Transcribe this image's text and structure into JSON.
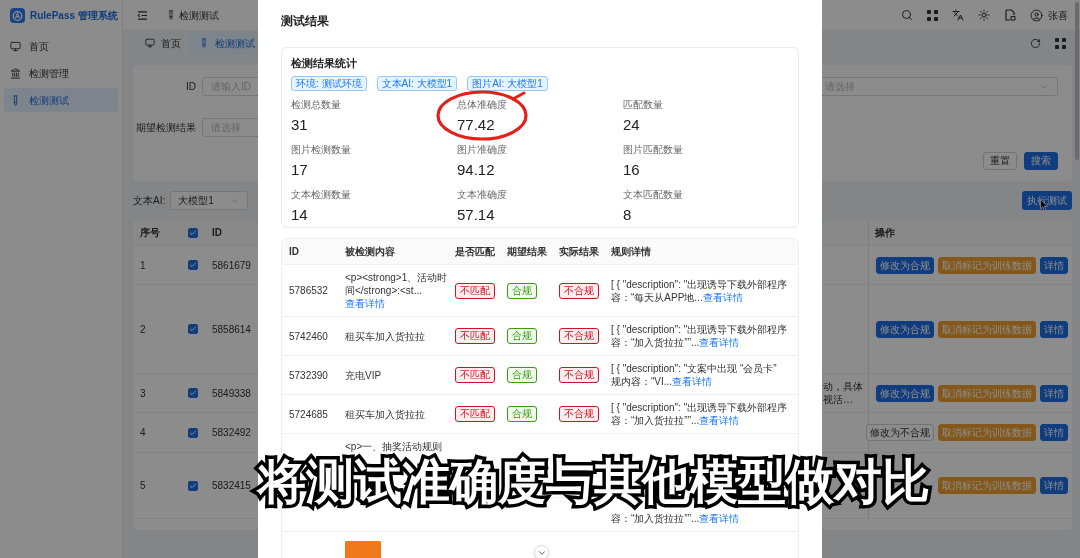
{
  "sidebar": {
    "logo": "RulePass 管理系统",
    "items": [
      {
        "label": "首页",
        "selected": false
      },
      {
        "label": "检测管理",
        "selected": false
      },
      {
        "label": "检测测试",
        "selected": true
      }
    ]
  },
  "header": {
    "breadcrumb": "检测测试",
    "user": "张喜"
  },
  "page_tabs": [
    {
      "label": "首页",
      "selected": false
    },
    {
      "label": "检测测试",
      "selected": true
    }
  ],
  "search_form": {
    "fields": [
      {
        "label": "ID",
        "placeholder": "请输入ID"
      },
      {
        "label": "期望检测结果",
        "placeholder": "请选择"
      }
    ],
    "select": {
      "placeholder": "请选择"
    },
    "buttons": [
      {
        "label": "重置",
        "kind": "default"
      },
      {
        "label": "搜索",
        "kind": "primary"
      }
    ]
  },
  "toolbar": {
    "label": "文本AI:",
    "select_value": "大模型1",
    "run_button": "执行测试"
  },
  "table": {
    "columns": [
      "序号",
      "ID",
      "操作"
    ],
    "all_checked": true,
    "rows": [
      {
        "index": "1",
        "checked": true,
        "id": "5861679",
        "actions": [
          {
            "label": "修改为合规",
            "kind": "primary"
          },
          {
            "label": "取消标记为训练数据",
            "kind": "warning"
          },
          {
            "label": "详情",
            "kind": "primary"
          }
        ]
      },
      {
        "index": "2",
        "checked": true,
        "id": "5858614",
        "actions": [
          {
            "label": "修改为合规",
            "kind": "primary"
          },
          {
            "label": "取消标记为训练数据",
            "kind": "warning"
          },
          {
            "label": "详情",
            "kind": "primary"
          }
        ]
      },
      {
        "index": "3",
        "checked": true,
        "id": "5849338",
        "detail": "动，具体视活…",
        "actions": [
          {
            "label": "修改为合规",
            "kind": "primary"
          },
          {
            "label": "取消标记为训练数据",
            "kind": "warning"
          },
          {
            "label": "详情",
            "kind": "primary"
          }
        ]
      },
      {
        "index": "4",
        "checked": true,
        "id": "5832492",
        "actions": [
          {
            "label": "修改为不合规",
            "kind": "default"
          },
          {
            "label": "取消标记为训练数据",
            "kind": "warning"
          },
          {
            "label": "详情",
            "kind": "primary"
          }
        ]
      },
      {
        "index": "5",
        "checked": true,
        "id": "5832415",
        "actions": [
          {
            "label": "取消标记为训练数据",
            "kind": "warning"
          },
          {
            "label": "详情",
            "kind": "primary"
          }
        ]
      }
    ]
  },
  "modal": {
    "title": "测试结果",
    "stats_card": {
      "title": "检测结果统计",
      "tags": [
        "环境: 测试环境",
        "文本AI: 大模型1",
        "图片AI: 大模型1"
      ],
      "stats": [
        {
          "label": "检测总数量",
          "value": "31"
        },
        {
          "label": "总体准确度",
          "value": "77.42"
        },
        {
          "label": "匹配数量",
          "value": "24"
        },
        {
          "label": "图片检测数量",
          "value": "17"
        },
        {
          "label": "图片准确度",
          "value": "94.12"
        },
        {
          "label": "图片匹配数量",
          "value": "16"
        },
        {
          "label": "文本检测数量",
          "value": "14"
        },
        {
          "label": "文本准确度",
          "value": "57.14"
        },
        {
          "label": "文本匹配数量",
          "value": "8"
        }
      ]
    },
    "results_table": {
      "columns": [
        "ID",
        "被检测内容",
        "是否匹配",
        "期望结果",
        "实际结果",
        "规则详情"
      ],
      "rows": [
        {
          "kind": "full",
          "id": "5786532",
          "content": "<p><strong>1、活动时间</strong>:<st...",
          "content_link": "查看详情",
          "match": {
            "text": "不匹配",
            "color": "#cf1322"
          },
          "expected": {
            "text": "合规",
            "color": "#389e0d"
          },
          "actual": {
            "text": "不合规",
            "color": "#cf1322"
          },
          "rule": [
            "[ { \"description\": \"出现诱导下载外部程序",
            "容：“每天从APP地..."
          ],
          "rule_link": "查看详情"
        },
        {
          "kind": "full",
          "id": "5742460",
          "content": "租买车加入货拉拉",
          "match": {
            "text": "不匹配",
            "color": "#cf1322"
          },
          "expected": {
            "text": "合规",
            "color": "#389e0d"
          },
          "actual": {
            "text": "不合规",
            "color": "#cf1322"
          },
          "rule": [
            "[ { \"description\": \"出现诱导下载外部程序",
            "容：“加入货拉拉””..."
          ],
          "rule_link": "查看详情"
        },
        {
          "kind": "full",
          "id": "5732390",
          "content": "充电VIP",
          "match": {
            "text": "不匹配",
            "color": "#cf1322"
          },
          "expected": {
            "text": "合规",
            "color": "#389e0d"
          },
          "actual": {
            "text": "不合规",
            "color": "#cf1322"
          },
          "rule": [
            "[ { \"description\": \"文案中出现 “会员卡”",
            "规内容：“VI..."
          ],
          "rule_link": "查看详情"
        },
        {
          "kind": "full",
          "id": "5724685",
          "content": "租买车加入货拉拉",
          "match": {
            "text": "不匹配",
            "color": "#cf1322"
          },
          "expected": {
            "text": "合规",
            "color": "#389e0d"
          },
          "actual": {
            "text": "不合规",
            "color": "#cf1322"
          },
          "rule": [
            "[ { \"description\": \"出现诱导下载外部程序",
            "容：“加入货拉拉””..."
          ],
          "rule_link": "查看详情"
        },
        {
          "kind": "top",
          "content": "<p>一、抽奖活动规则"
        },
        {
          "kind": "bottom",
          "rule": [
            "容：“加入货拉拉””..."
          ],
          "rule_link": "查看详情"
        },
        {
          "kind": "image"
        }
      ]
    }
  },
  "caption": "将测试准确度与其他模型做对比"
}
